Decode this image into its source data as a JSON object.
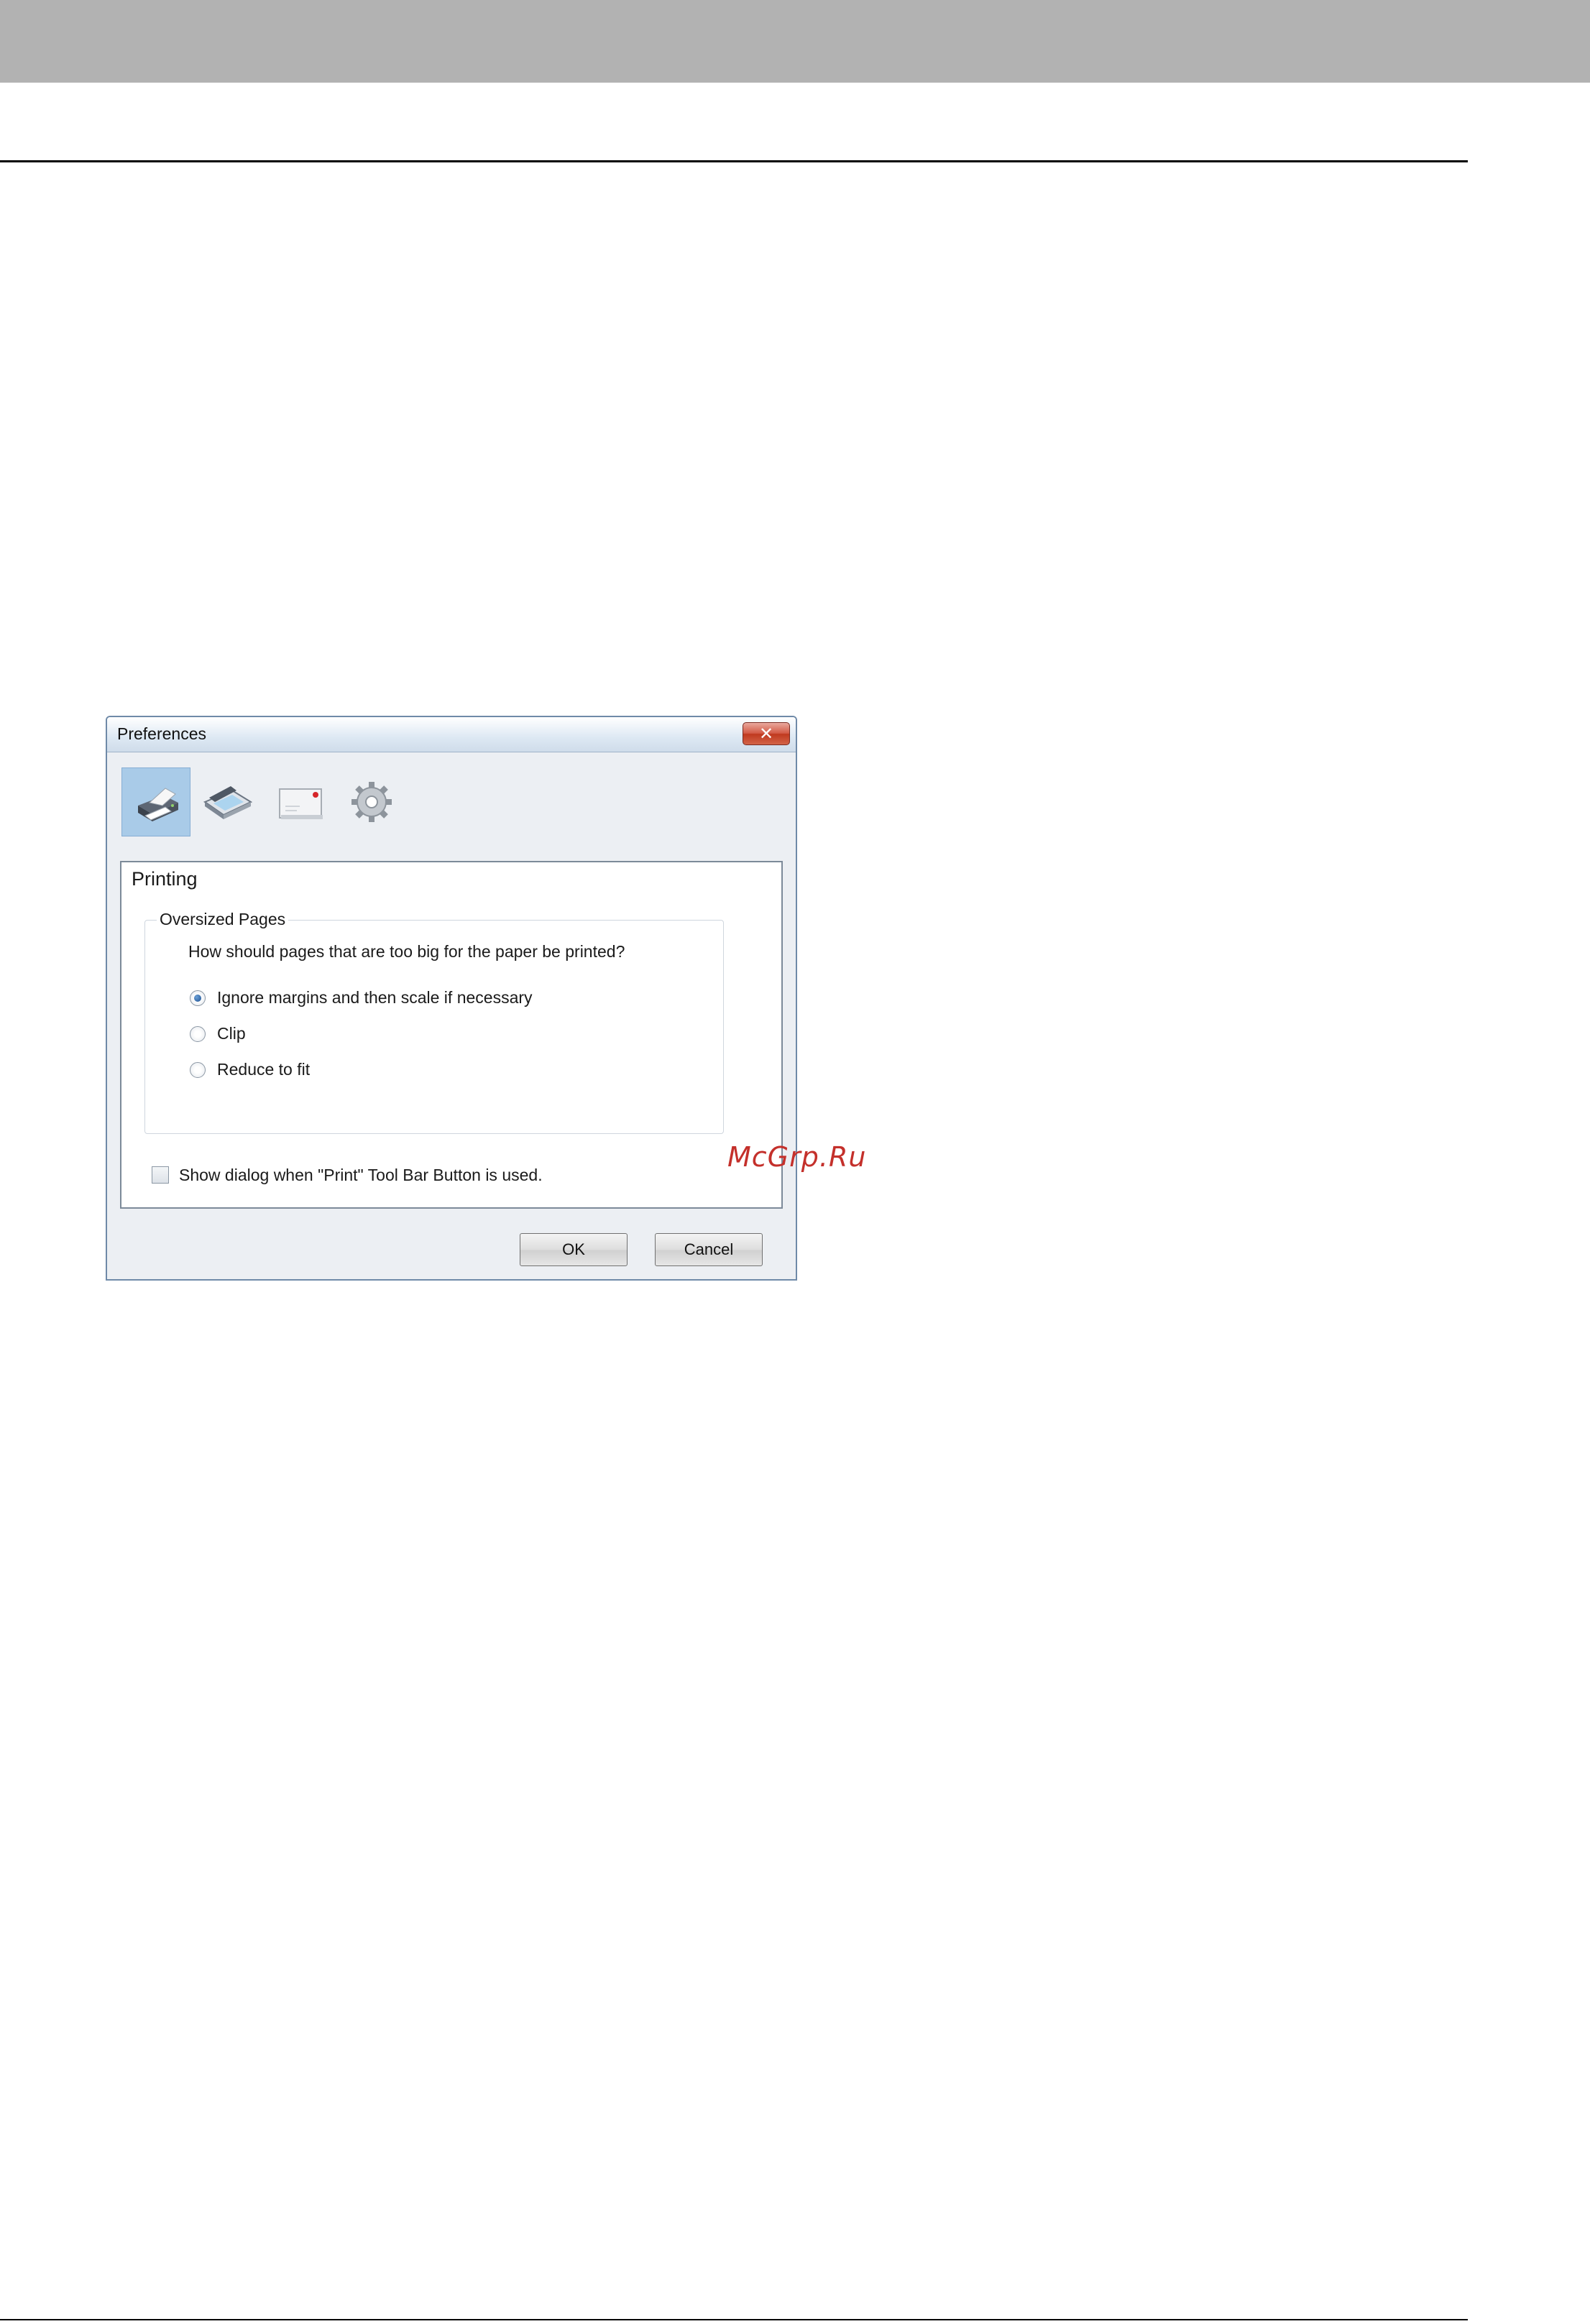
{
  "dialog": {
    "title": "Preferences",
    "close_label": "✕",
    "toolbar": {
      "icons": [
        "printer-icon",
        "scanner-icon",
        "email-icon",
        "gear-icon"
      ],
      "selected": "printer-icon"
    },
    "panel": {
      "title": "Printing",
      "group": {
        "legend": "Oversized Pages",
        "question": "How should pages that are too big for the paper be printed?",
        "options": [
          {
            "label": "Ignore margins and then scale if necessary",
            "checked": true
          },
          {
            "label": "Clip",
            "checked": false
          },
          {
            "label": "Reduce to fit",
            "checked": false
          }
        ]
      },
      "show_dialog_checkbox": {
        "label": "Show dialog when \"Print\" Tool Bar Button is used.",
        "checked": false
      }
    },
    "buttons": {
      "ok_label": "OK",
      "cancel_label": "Cancel"
    }
  },
  "watermark": "McGrp.Ru",
  "colors": {
    "header_band": "#b2b2b2",
    "selected_tab": "#a9cbe8",
    "close_button": "#c84a33",
    "watermark": "#c4302b"
  }
}
